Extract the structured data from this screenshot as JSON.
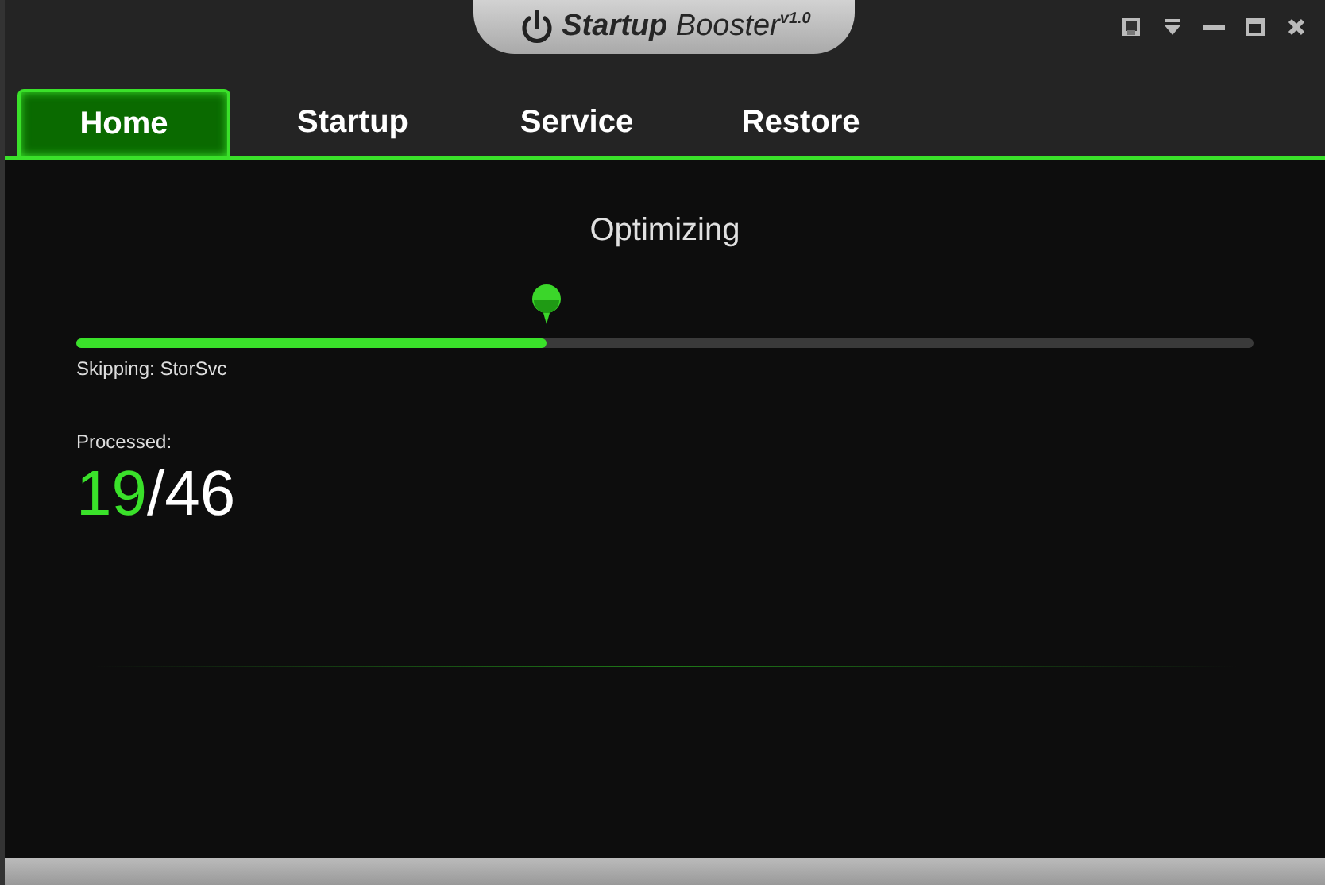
{
  "window": {
    "title": "**Startup** Booster$^{v1.0}$"
  },
  "tabs": [
    {
      "label": "Home",
      "selected": true
    },
    {
      "label": "Startup",
      "selected": false
    },
    {
      "label": "Service",
      "selected": false
    },
    {
      "label": "Restore",
      "selected": false
    }
  ],
  "progress": {
    "heading": "Optimizing",
    "level": 0.4,
    "status": "Skipping: StorSvc"
  },
  "processed": {
    "label": "Processed:",
    "done": "19",
    "separator": "/",
    "total": "46"
  }
}
